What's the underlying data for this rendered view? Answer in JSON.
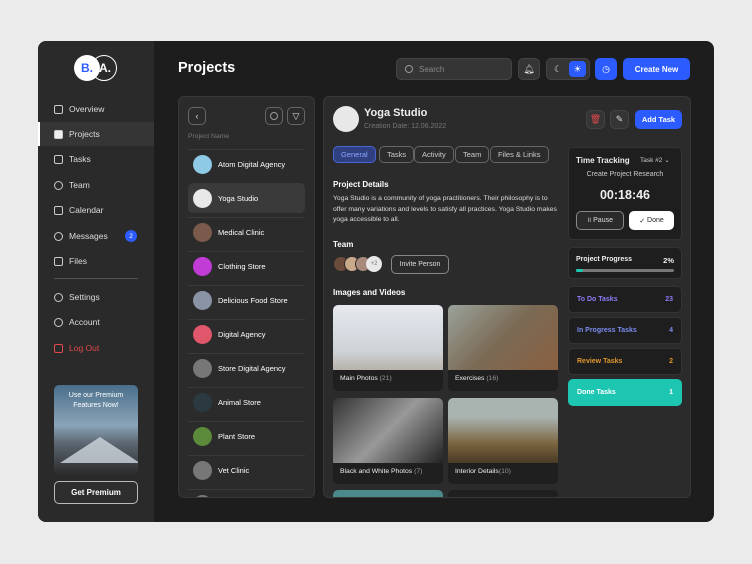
{
  "logo": {
    "left": "B.",
    "right": "A."
  },
  "sidebar": {
    "items": [
      {
        "label": "Overview"
      },
      {
        "label": "Projects"
      },
      {
        "label": "Tasks"
      },
      {
        "label": "Team"
      },
      {
        "label": "Calendar"
      },
      {
        "label": "Messages",
        "badge": "2"
      },
      {
        "label": "Files"
      }
    ],
    "bottom": [
      {
        "label": "Settings"
      },
      {
        "label": "Account"
      },
      {
        "label": "Log Out"
      }
    ],
    "promo": {
      "text": "Use our Premium Features Now!",
      "button": "Get Premium"
    }
  },
  "header": {
    "title": "Projects",
    "search_placeholder": "Search",
    "create_label": "Create New"
  },
  "projects": {
    "column": "Project Name",
    "items": [
      {
        "name": "Atom Digital Agency",
        "color": "#8ecae6"
      },
      {
        "name": "Yoga Studio",
        "color": "#e8e8e8"
      },
      {
        "name": "Medical Clinic",
        "color": "#7a5a4a"
      },
      {
        "name": "Clothing Store",
        "color": "#c13bd6"
      },
      {
        "name": "Delicious Food Store",
        "color": "#8a94a6"
      },
      {
        "name": "Digital Agency",
        "color": "#e0566a"
      },
      {
        "name": "Store Digital Agency",
        "color": "#777"
      },
      {
        "name": "Animal Store",
        "color": "#2a3a40"
      },
      {
        "name": "Plant Store",
        "color": "#5a8a3a"
      },
      {
        "name": "Vet Clinic",
        "color": "#777"
      }
    ]
  },
  "detail": {
    "title": "Yoga Studio",
    "date": "Creation Date: 12.06.2022",
    "add_task": "Add Task",
    "tabs": [
      "General",
      "Tasks",
      "Activity",
      "Team",
      "Files & Links"
    ],
    "details_heading": "Project Details",
    "description": "Yoga Studio is a community of yoga practitioners. Their philosophy is to offer many variations and levels to satisfy all practices. Yoga Studio makes yoga accessible to all.",
    "team_heading": "Team",
    "team_more": "+2",
    "invite": "Invite Person",
    "media_heading": "Images and Videos",
    "media": [
      {
        "label": "Main Photos",
        "count": "(21)"
      },
      {
        "label": "Exercises",
        "count": "(16)"
      },
      {
        "label": "Black and White Photos",
        "count": "(7)"
      },
      {
        "label": "Interior Details",
        "count": "(10)"
      }
    ]
  },
  "tracking": {
    "title": "Time Tracking",
    "task": "Task #2",
    "task_name": "Create Project Research",
    "time": "00:18:46",
    "pause": "Pause",
    "done": "Done"
  },
  "progress": {
    "label": "Project Progress",
    "value": "2%",
    "fraction": 0.02
  },
  "stats": [
    {
      "label": "To Do Tasks",
      "value": "23",
      "color": "#8b7cf6"
    },
    {
      "label": "In Progress Tasks",
      "value": "4",
      "color": "#7b8cf0"
    },
    {
      "label": "Review Tasks",
      "value": "2",
      "color": "#e0982f"
    },
    {
      "label": "Done Tasks",
      "value": "1",
      "color": "#ffffff"
    }
  ]
}
